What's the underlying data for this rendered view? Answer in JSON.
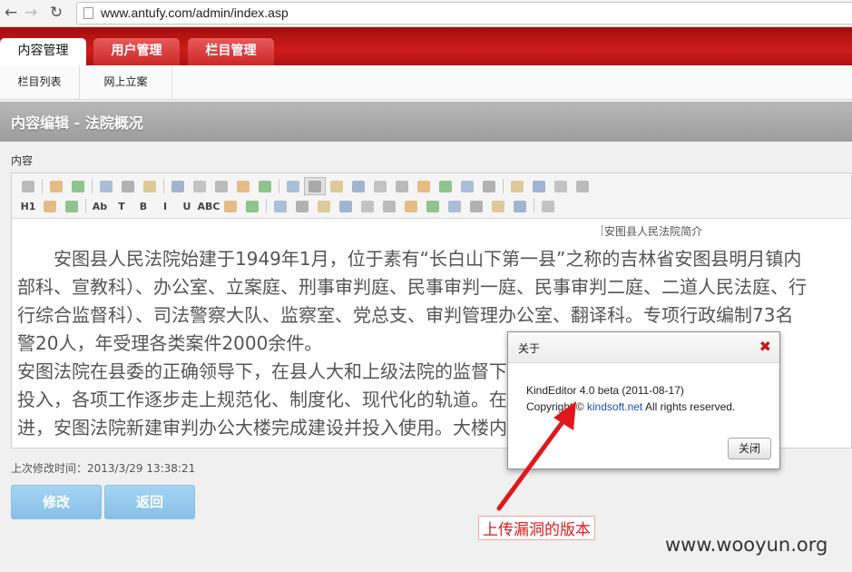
{
  "browser": {
    "url": "www.antufy.com/admin/index.asp",
    "back_icon": "back-arrow-icon",
    "forward_icon": "forward-arrow-icon",
    "reload_icon": "reload-icon"
  },
  "header": {
    "tabs": [
      {
        "label": "内容管理",
        "active": true
      },
      {
        "label": "用户管理",
        "active": false
      },
      {
        "label": "栏目管理",
        "active": false
      }
    ],
    "accent_color": "#c41a1a"
  },
  "subnav": {
    "items": [
      {
        "label": "栏目列表"
      },
      {
        "label": "网上立案"
      }
    ]
  },
  "page": {
    "title": "内容编辑 - 法院概况",
    "content_label": "内容"
  },
  "toolbar": {
    "row1_icons": [
      "source-icon",
      "undo-icon",
      "redo-icon",
      "preview-icon",
      "print-icon",
      "template-icon",
      "cut-icon",
      "copy-icon",
      "paste-icon",
      "paste-plain-icon",
      "paste-word-icon",
      "align-left-icon",
      "align-center-icon",
      "align-right-icon",
      "justify-icon",
      "ordered-list-icon",
      "unordered-list-icon",
      "indent-icon",
      "outdent-icon",
      "subscript-icon",
      "superscript-icon",
      "clear-format-icon",
      "select-all-icon",
      "pointer-icon",
      "fullscreen-icon"
    ],
    "row2_icons": [
      "heading-icon",
      "font-family-icon",
      "font-size-icon",
      "font-color-icon",
      "highlight-icon",
      "bold-icon",
      "italic-icon",
      "underline-icon",
      "strikethrough-icon",
      "line-height-icon",
      "remove-format-icon",
      "image-icon",
      "flash-icon",
      "media-icon",
      "insert-file-icon",
      "table-icon",
      "hr-icon",
      "emoticon-icon",
      "baidu-map-icon",
      "code-icon",
      "page-break-icon",
      "link-icon",
      "unlink-icon",
      "about-icon"
    ],
    "row2_text": {
      "heading": "H1",
      "font_color": "Ab",
      "highlight": "T",
      "bold": "B",
      "italic": "I",
      "underline": "U",
      "strike": "ABC"
    }
  },
  "editor": {
    "image_alt": "安图县人民法院简介",
    "paragraphs": [
      "　　安图县人民法院始建于1949年1月，位于素有“长白山下第一县”之称的吉林省安图县明月镇内",
      "部科、宣教科）、办公室、立案庭、刑事审判庭、民事审判一庭、民事审判二庭、二道人民法庭、行",
      "行综合监督科）、司法警察大队、监察室、党总支、审判管理办公室、翻译科。专项行政编制73名",
      "警20人，年受理各类案件2000余件。",
      "安图法院在县委的正确领导下，在县人大和上级法院的监督下，依法独立公正地行使审判、执行",
      "投入，各项工作逐步走上规范化、制度化、现代化的轨道。在县委的正确领导下，全体",
      "进，安图法院新建审判办公大楼完成建设并投入使用。大楼内设有大型审判庭"
    ]
  },
  "footer": {
    "last_modified": "上次修改时间：2013/3/29 13:38:21",
    "modify_label": "修改",
    "back_label": "返回"
  },
  "dialog": {
    "title": "关于",
    "version": "KindEditor 4.0 beta (2011-08-17)",
    "copyright_prefix": "Copyright ©",
    "link": "kindsoft.net",
    "copyright_suffix": "All rights reserved.",
    "close_label": "关闭",
    "close_icon": "close-x-icon"
  },
  "annotation": {
    "label": "上传漏洞的版本",
    "color": "#e0181b"
  },
  "watermark": "www.wooyun.org"
}
